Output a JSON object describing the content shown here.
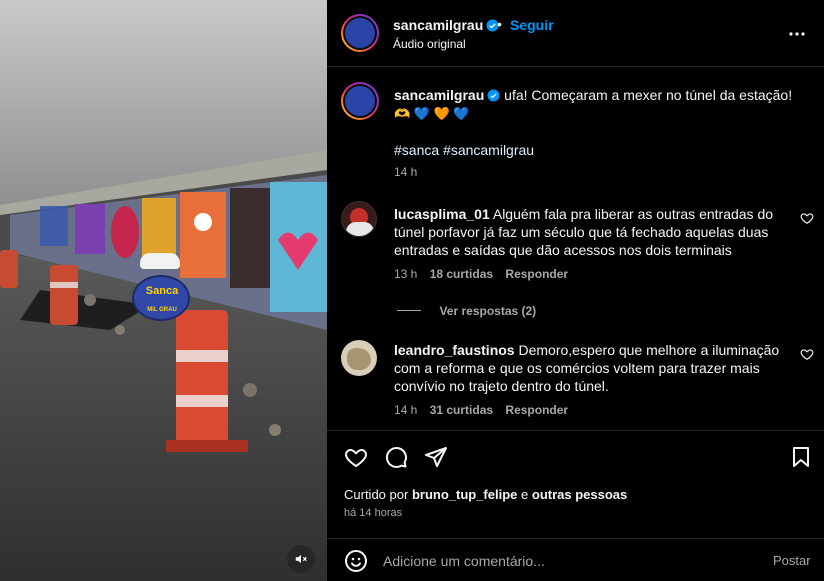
{
  "post": {
    "username": "sancamilgrau",
    "follow_label": "Seguir",
    "separator": "•",
    "audio": "Áudio original",
    "caption_user": "sancamilgrau",
    "caption_text": "ufa! Começaram a mexer no túnel da estação!",
    "caption_emojis": "🫶 💙 🧡 💙",
    "hashtags": "#sanca #sancamilgrau",
    "caption_time": "14 h"
  },
  "overlay": {
    "logo_text": "Sanca",
    "logo_subtext": "MIL GRAU"
  },
  "comments": [
    {
      "username": "lucasplima_01",
      "text": "Alguém fala pra liberar as outras entradas do túnel porfavor já faz um século que tá fechado aquelas duas entradas e saídas que dão acessos nos dois terminais",
      "time": "13 h",
      "likes": "18 curtidas",
      "reply": "Responder",
      "view_replies": "Ver respostas (2)"
    },
    {
      "username": "leandro_faustinos",
      "text": "Demoro,espero que melhore a iluminação com a reforma e que os comércios voltem para trazer mais convívio no trajeto dentro do túnel.",
      "time": "14 h",
      "likes": "31 curtidas",
      "reply": "Responder"
    }
  ],
  "likes": {
    "prefix": "Curtido por",
    "user": "bruno_tup_felipe",
    "conj": "e",
    "others": "outras pessoas",
    "when": "há 14 horas"
  },
  "composer": {
    "placeholder": "Adicione um comentário...",
    "post_label": "Postar"
  },
  "icons": {
    "verified": "verified-badge-icon",
    "more": "more-options-icon",
    "like": "heart-icon",
    "comment": "comment-icon",
    "share": "share-icon",
    "save": "bookmark-icon",
    "emoji": "emoji-icon",
    "mute": "muted-speaker-icon"
  },
  "colors": {
    "accent": "#0095f6",
    "verified": "#0095f6",
    "muted_text": "#a8a8a8",
    "background": "#000000"
  }
}
